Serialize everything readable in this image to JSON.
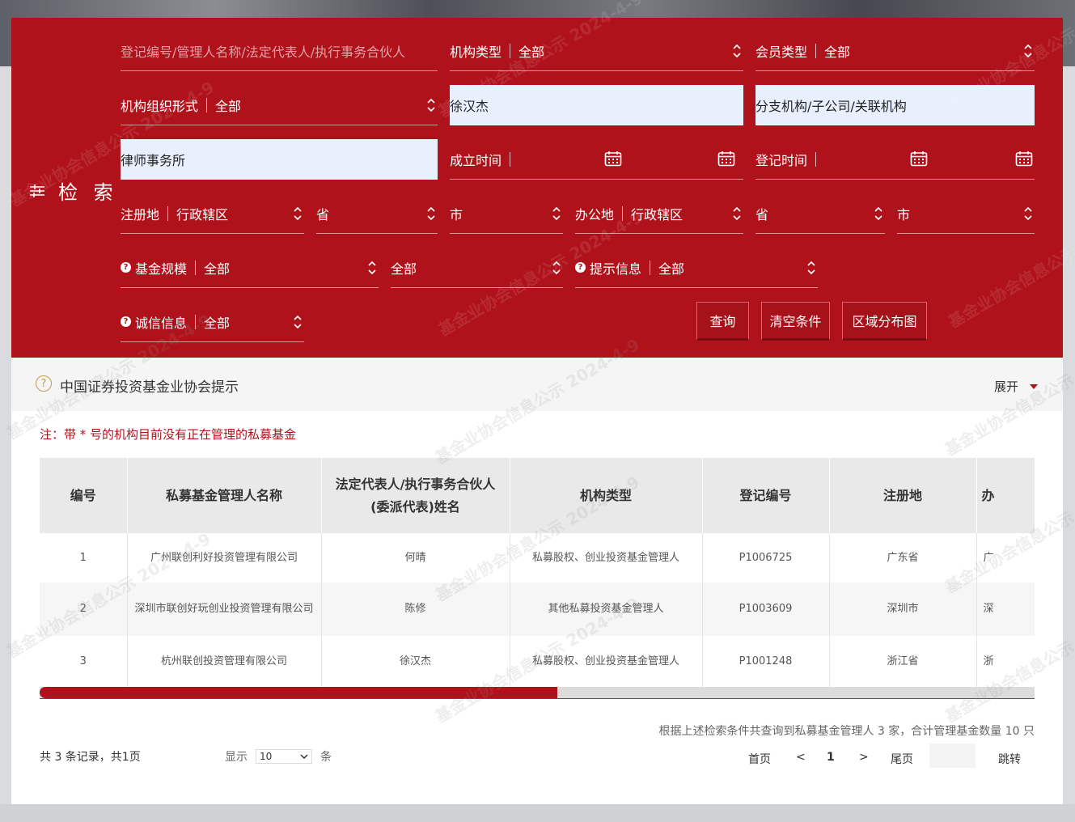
{
  "search": {
    "label": "检 索",
    "keyword_placeholder": "登记编号/管理人名称/法定代表人/执行事务合伙人",
    "org_type": {
      "label": "机构类型",
      "value": "全部"
    },
    "member_type": {
      "label": "会员类型",
      "value": "全部"
    },
    "org_form": {
      "label": "机构组织形式",
      "value": "全部"
    },
    "rep_value": "徐汉杰",
    "branch_value": "分支机构/子公司/关联机构",
    "law_firm_value": "律师事务所",
    "established": {
      "label": "成立时间"
    },
    "registered": {
      "label": "登记时间"
    },
    "reg_place": {
      "label": "注册地",
      "district": "行政辖区",
      "province": "省",
      "city": "市"
    },
    "office_place": {
      "label": "办公地",
      "district": "行政辖区",
      "province": "省",
      "city": "市"
    },
    "fund_scale": {
      "label": "基金规模",
      "value": "全部",
      "value2": "全部"
    },
    "hint_info": {
      "label": "提示信息",
      "value": "全部"
    },
    "integrity": {
      "label": "诚信信息",
      "value": "全部"
    },
    "buttons": {
      "query": "查询",
      "clear": "清空条件",
      "map": "区域分布图"
    }
  },
  "notice": {
    "title": "中国证券投资基金业协会提示",
    "expand": "展开"
  },
  "note": "注：带 * 号的机构目前没有正在管理的私募基金",
  "table": {
    "headers": [
      "编号",
      "私募基金管理人名称",
      "法定代表人/执行事务合伙人(委派代表)姓名",
      "机构类型",
      "登记编号",
      "注册地",
      "办"
    ],
    "rows": [
      {
        "no": "1",
        "name": "广州联创利好投资管理有限公司",
        "rep": "何晴",
        "type": "私募股权、创业投资基金管理人",
        "code": "P1006725",
        "place": "广东省",
        "office": "广"
      },
      {
        "no": "2",
        "name": "深圳市联创好玩创业投资管理有限公司",
        "rep": "陈修",
        "type": "其他私募投资基金管理人",
        "code": "P1003609",
        "place": "深圳市",
        "office": "深"
      },
      {
        "no": "3",
        "name": "杭州联创投资管理有限公司",
        "rep": "徐汉杰",
        "type": "私募股权、创业投资基金管理人",
        "code": "P1001248",
        "place": "浙江省",
        "office": "浙"
      }
    ]
  },
  "scroll_position": 0.52,
  "summary": "根据上述检索条件共查询到私募基金管理人 3 家，合计管理基金数量 10 只",
  "pagination": {
    "records": "共 3 条记录，共1页",
    "show": "显示",
    "size": "10",
    "unit": "条",
    "first": "首页",
    "prev": "<",
    "current": "1",
    "next": ">",
    "last": "尾页",
    "jump": "跳转"
  },
  "watermark": "基金业协会信息公示 2024-4-9",
  "colors": {
    "brand_red": "#b0121b",
    "autofill_blue": "#e8f0fe"
  }
}
